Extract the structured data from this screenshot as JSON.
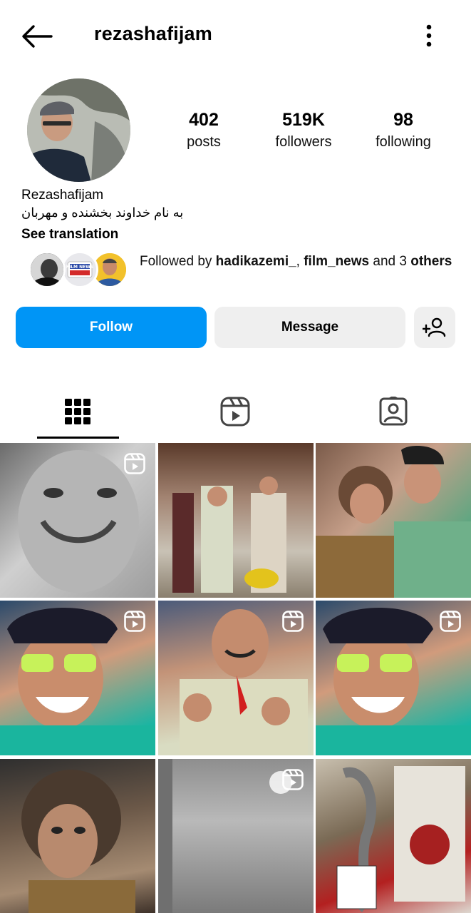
{
  "header": {
    "username": "rezashafijam",
    "back_icon": "arrow-left-icon",
    "menu_icon": "more-vertical-icon"
  },
  "profile": {
    "avatar_icon": "profile-avatar",
    "stats": [
      {
        "value": "402",
        "label": "posts"
      },
      {
        "value": "519K",
        "label": "followers"
      },
      {
        "value": "98",
        "label": "following"
      }
    ],
    "full_name": "Rezashafijam",
    "bio": "به نام خداوند بخشنده و مهربان",
    "see_translation": "See translation"
  },
  "followed_by": {
    "prefix": "Followed by ",
    "user1": "hadikazemi_",
    "separator": ", ",
    "user2": "film_news",
    "middle": " and 3 ",
    "suffix": "others",
    "avatar3_text": "FILM NEWS"
  },
  "actions": {
    "follow_label": "Follow",
    "message_label": "Message",
    "add_user_icon": "add-person-icon"
  },
  "tabs": [
    {
      "name": "posts",
      "icon": "grid-icon",
      "active": true
    },
    {
      "name": "reels",
      "icon": "reels-icon",
      "active": false
    },
    {
      "name": "tagged",
      "icon": "tagged-person-icon",
      "active": false
    }
  ],
  "colors": {
    "follow_button": "#0095f6",
    "secondary_button": "#efefef"
  },
  "posts": [
    {
      "is_reel": true
    },
    {
      "is_reel": false
    },
    {
      "is_reel": false
    },
    {
      "is_reel": true
    },
    {
      "is_reel": true
    },
    {
      "is_reel": true
    },
    {
      "is_reel": false
    },
    {
      "is_reel": true
    },
    {
      "is_reel": false
    }
  ]
}
